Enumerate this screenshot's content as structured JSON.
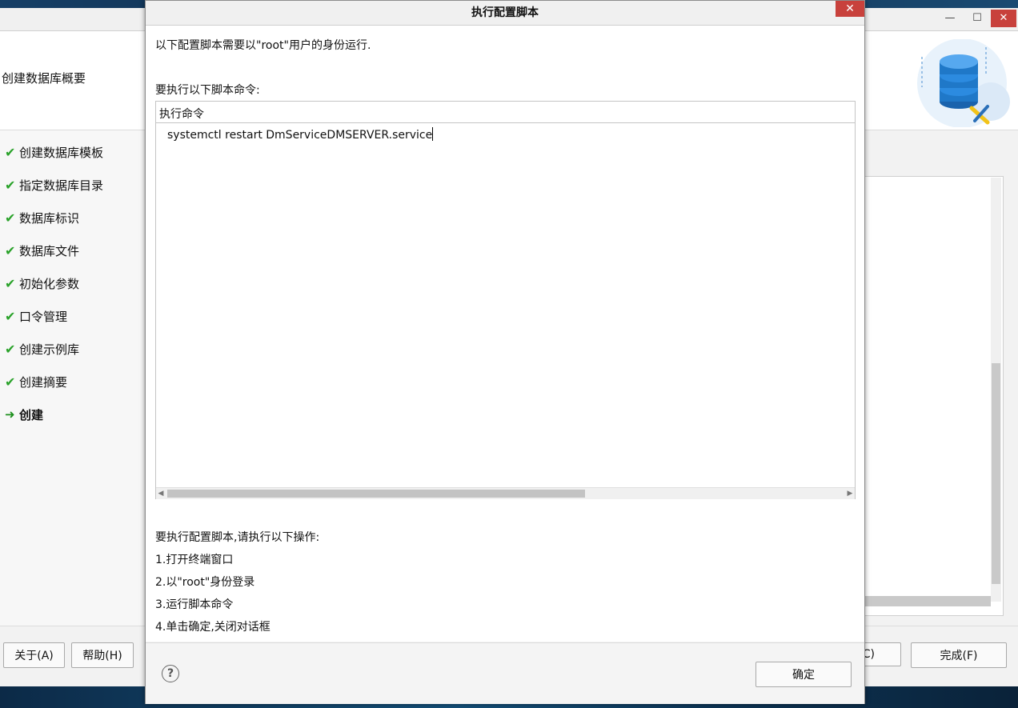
{
  "wizard": {
    "header_title": "创建数据库概要",
    "steps": [
      {
        "label": "创建数据库模板",
        "state": "done"
      },
      {
        "label": "指定数据库目录",
        "state": "done"
      },
      {
        "label": "数据库标识",
        "state": "done"
      },
      {
        "label": "数据库文件",
        "state": "done"
      },
      {
        "label": "初始化参数",
        "state": "done"
      },
      {
        "label": "口令管理",
        "state": "done"
      },
      {
        "label": "创建示例库",
        "state": "done"
      },
      {
        "label": "创建摘要",
        "state": "done"
      },
      {
        "label": "创建",
        "state": "current"
      }
    ],
    "footer": {
      "about_label": "关于(A)",
      "help_label": "帮助(H)",
      "cancel_partial_label": "C)",
      "finish_label": "完成(F)"
    },
    "window_buttons": {
      "minimize": "—",
      "maximize": "☐",
      "close": "✕"
    }
  },
  "dialog": {
    "title": "执行配置脚本",
    "close_glyph": "✕",
    "intro": "以下配置脚本需要以\"root\"用户的身份运行.",
    "table_caption": "要执行以下脚本命令:",
    "table_header": "执行命令",
    "commands": [
      "systemctl restart DmServiceDMSERVER.service"
    ],
    "instructions_title": "要执行配置脚本,请执行以下操作:",
    "instructions": [
      "1.打开终端窗口",
      "2.以\"root\"身份登录",
      "3.运行脚本命令",
      "4.单击确定,关闭对话框"
    ],
    "ok_label": "确定",
    "help_glyph": "?"
  },
  "colors": {
    "check_green": "#2aa22a",
    "close_red": "#c8413c",
    "db_blue": "#1f78c8"
  }
}
